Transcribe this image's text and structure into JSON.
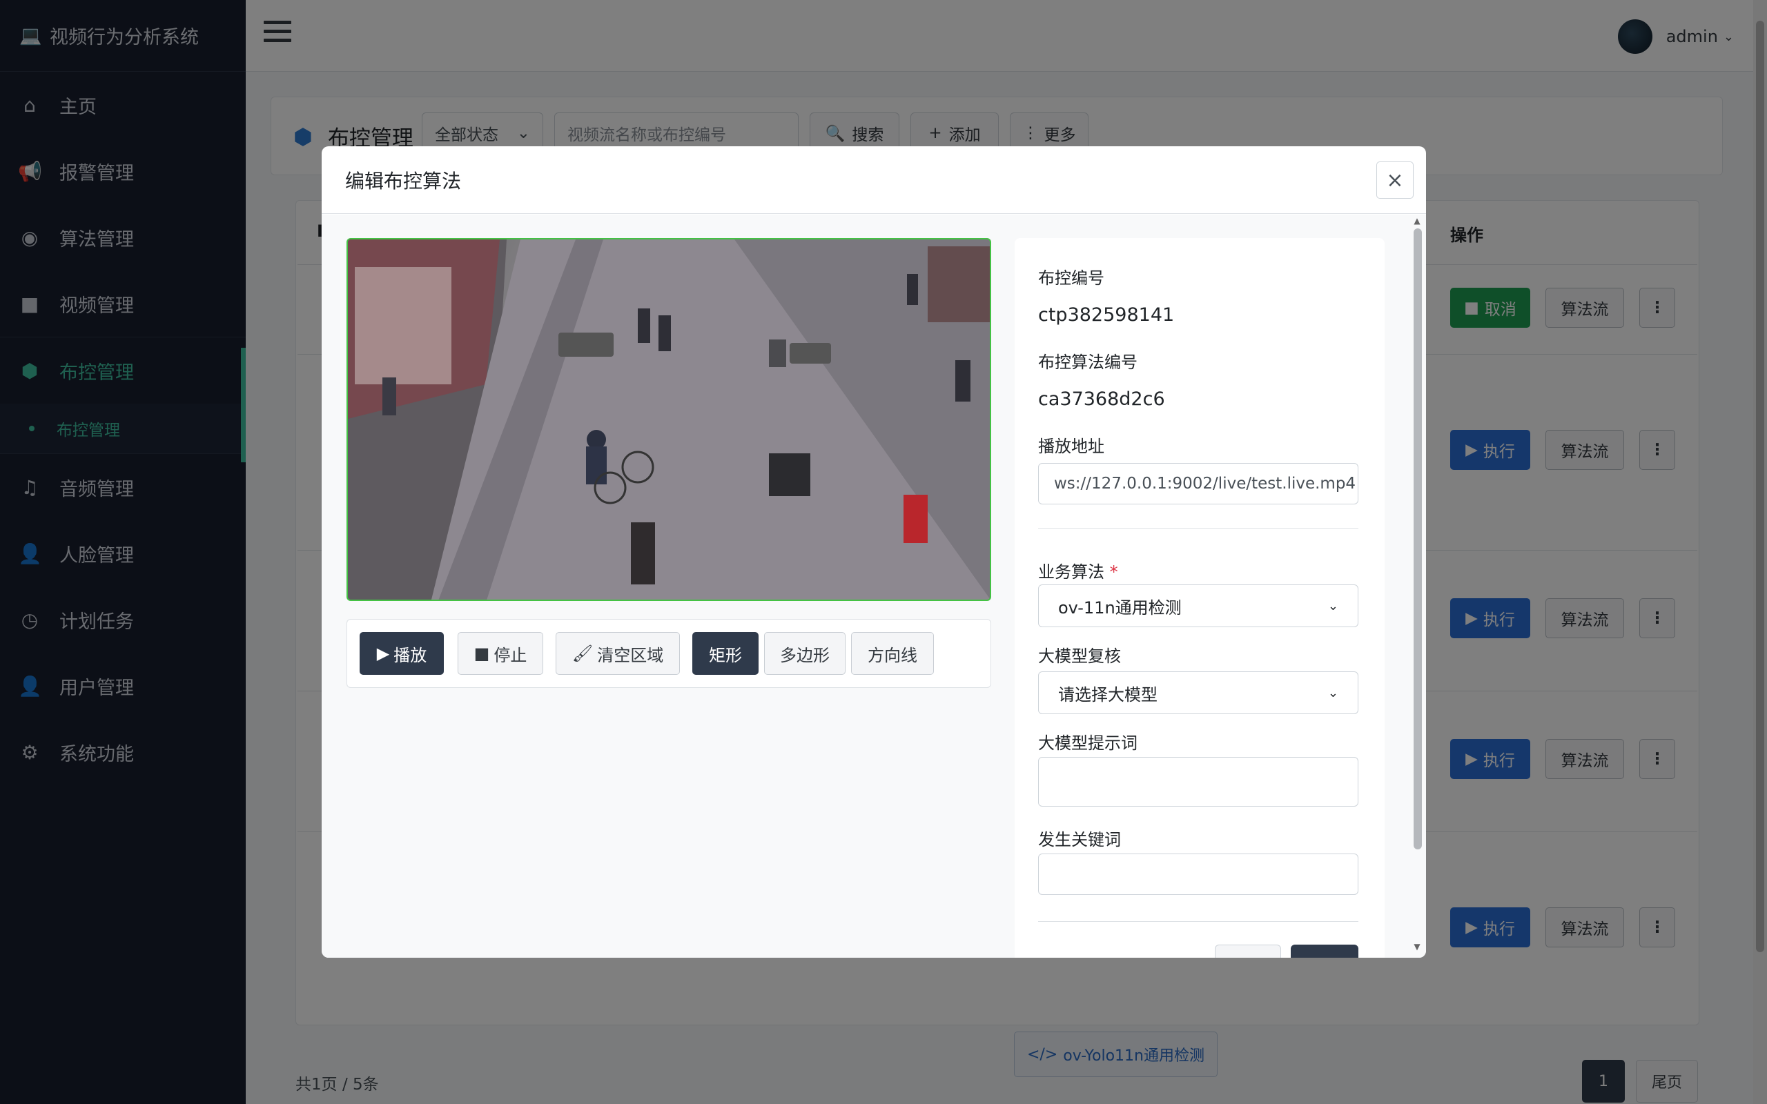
{
  "sidebar": {
    "brand": "视频行为分析系统",
    "items": [
      {
        "label": "主页",
        "icon": "home-icon"
      },
      {
        "label": "报警管理",
        "icon": "megaphone-icon"
      },
      {
        "label": "算法管理",
        "icon": "eye-icon"
      },
      {
        "label": "视频管理",
        "icon": "video-camera-icon"
      },
      {
        "label": "布控管理",
        "icon": "cube-icon"
      },
      {
        "label": "音频管理",
        "icon": "music-icon"
      },
      {
        "label": "人脸管理",
        "icon": "user-plus-icon"
      },
      {
        "label": "计划任务",
        "icon": "clock-icon"
      },
      {
        "label": "用户管理",
        "icon": "user-icon"
      },
      {
        "label": "系统功能",
        "icon": "gear-icon"
      }
    ],
    "sub_item": "布控管理"
  },
  "topbar": {
    "username": "admin"
  },
  "page": {
    "title": "布控管理",
    "status_filter": "全部状态",
    "search_placeholder": "视频流名称或布控编号",
    "search_label": "搜索",
    "add_label": "添加",
    "more_label": "更多",
    "col_partial": "I",
    "col_actions": "操作",
    "rows": [
      {
        "primary": "取消",
        "primary_kind": "green",
        "secondary": "算法流"
      },
      {
        "primary": "执行",
        "primary_kind": "blue",
        "secondary": "算法流"
      },
      {
        "primary": "执行",
        "primary_kind": "blue",
        "secondary": "算法流"
      },
      {
        "primary": "执行",
        "primary_kind": "blue",
        "secondary": "算法流"
      },
      {
        "primary": "执行",
        "primary_kind": "blue",
        "secondary": "算法流"
      }
    ],
    "algorithm_tag": "ov-Yolo11n通用检测",
    "footer_count": "共1页 / 5条",
    "current_page": "1",
    "last_page_label": "尾页"
  },
  "modal": {
    "title": "编辑布控算法",
    "close": "×",
    "toolbar": {
      "play": "播放",
      "stop": "停止",
      "clear": "清空区域",
      "rect": "矩形",
      "polygon": "多边形",
      "direction": "方向线"
    },
    "form": {
      "control_id_label": "布控编号",
      "control_id": "ctp382598141",
      "algo_id_label": "布控算法编号",
      "algo_id": "ca37368d2c6",
      "play_url_label": "播放地址",
      "play_url": "ws://127.0.0.1:9002/live/test.live.mp4",
      "business_algo_label": "业务算法",
      "required_mark": "*",
      "business_algo": "ov-11n通用检测",
      "llm_review_label": "大模型复核",
      "llm_review": "请选择大模型",
      "llm_prompt_label": "大模型提示词",
      "llm_prompt": "",
      "keyword_label": "发生关键词",
      "keyword": ""
    }
  },
  "colors": {
    "sidebar_bg": "#181e2e",
    "accent": "#3fc1a1",
    "primary_blue": "#2b6fd6",
    "success_green": "#1e9e52",
    "dark_button": "#2f3a4b"
  }
}
